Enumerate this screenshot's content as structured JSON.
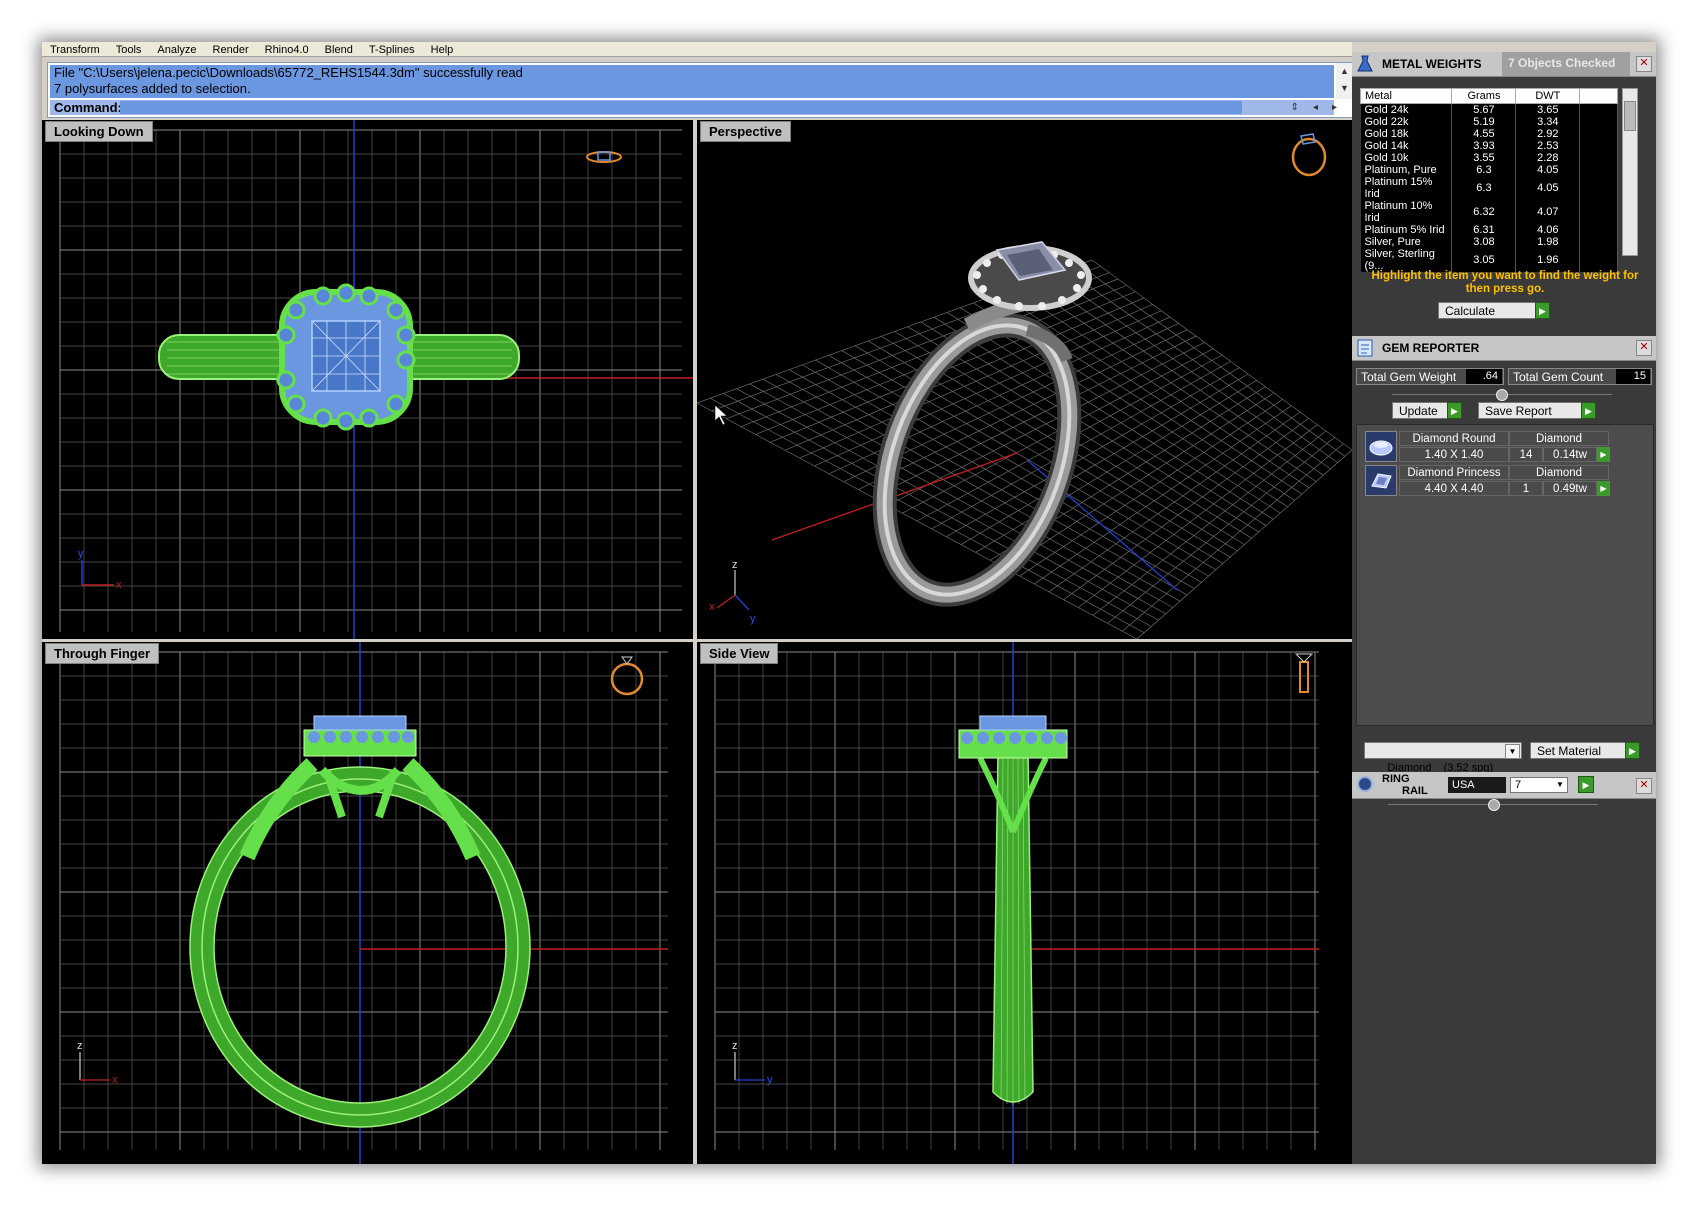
{
  "menu": [
    "Transform",
    "Tools",
    "Analyze",
    "Render",
    "Rhino4.0",
    "Blend",
    "T-Splines",
    "Help"
  ],
  "command": {
    "history": [
      "File \"C:\\Users\\jelena.pecic\\Downloads\\65772_REHS1544.3dm\" successfully read",
      "7 polysurfaces added to selection."
    ],
    "prompt_label": "Command:",
    "value": ""
  },
  "viewports": {
    "top_left": {
      "title": "Looking Down",
      "axis_labels": [
        "y",
        "x"
      ]
    },
    "top_right": {
      "title": "Perspective",
      "axis_labels": [
        "z",
        "y",
        "x"
      ]
    },
    "bottom_left": {
      "title": "Through Finger",
      "axis_labels": [
        "z",
        "x"
      ]
    },
    "bottom_right": {
      "title": "Side View",
      "axis_labels": [
        "z",
        "y"
      ]
    }
  },
  "metal_weights": {
    "title": "METAL WEIGHTS",
    "subtitle": "7 Objects Checked",
    "columns": [
      "Metal",
      "Grams",
      "DWT"
    ],
    "rows": [
      [
        "Gold 24k",
        "5.67",
        "3.65"
      ],
      [
        "Gold 22k",
        "5.19",
        "3.34"
      ],
      [
        "Gold 18k",
        "4.55",
        "2.92"
      ],
      [
        "Gold 14k",
        "3.93",
        "2.53"
      ],
      [
        "Gold 10k",
        "3.55",
        "2.28"
      ],
      [
        "Platinum, Pure",
        "6.3",
        "4.05"
      ],
      [
        "Platinum 15% Irid",
        "6.3",
        "4.05"
      ],
      [
        "Platinum 10% Irid",
        "6.32",
        "4.07"
      ],
      [
        "Platinum 5% Irid",
        "6.31",
        "4.06"
      ],
      [
        "Silver, Pure",
        "3.08",
        "1.98"
      ],
      [
        "Silver, Sterling (9...",
        "3.05",
        "1.96"
      ]
    ],
    "hint": "Highlight the item you want to find the weight for then press go.",
    "calculate_label": "Calculate"
  },
  "gem_reporter": {
    "title": "GEM REPORTER",
    "total_weight_label": "Total Gem Weight",
    "total_weight": ".64",
    "total_count_label": "Total Gem Count",
    "total_count": "15",
    "update_label": "Update",
    "save_label": "Save Report",
    "gems": [
      {
        "name": "Diamond Round",
        "material": "Diamond",
        "size": "1.40 X 1.40",
        "count": "14",
        "tw": "0.14tw"
      },
      {
        "name": "Diamond Princess",
        "material": "Diamond",
        "size": "4.40 X 4.40",
        "count": "1",
        "tw": "0.49tw"
      }
    ],
    "material_select": "Diamond    (3.52 spg)",
    "set_material_label": "Set Material"
  },
  "ring_rail": {
    "title_line1": "RING",
    "title_line2": "RAIL",
    "country": "USA",
    "size": "7"
  },
  "colors": {
    "wire_green": "#66e04a",
    "stone_blue": "#6b96e0",
    "history_bg": "#6b96e0",
    "hint_text": "#ffc000",
    "go_green": "#3a9a2a"
  }
}
